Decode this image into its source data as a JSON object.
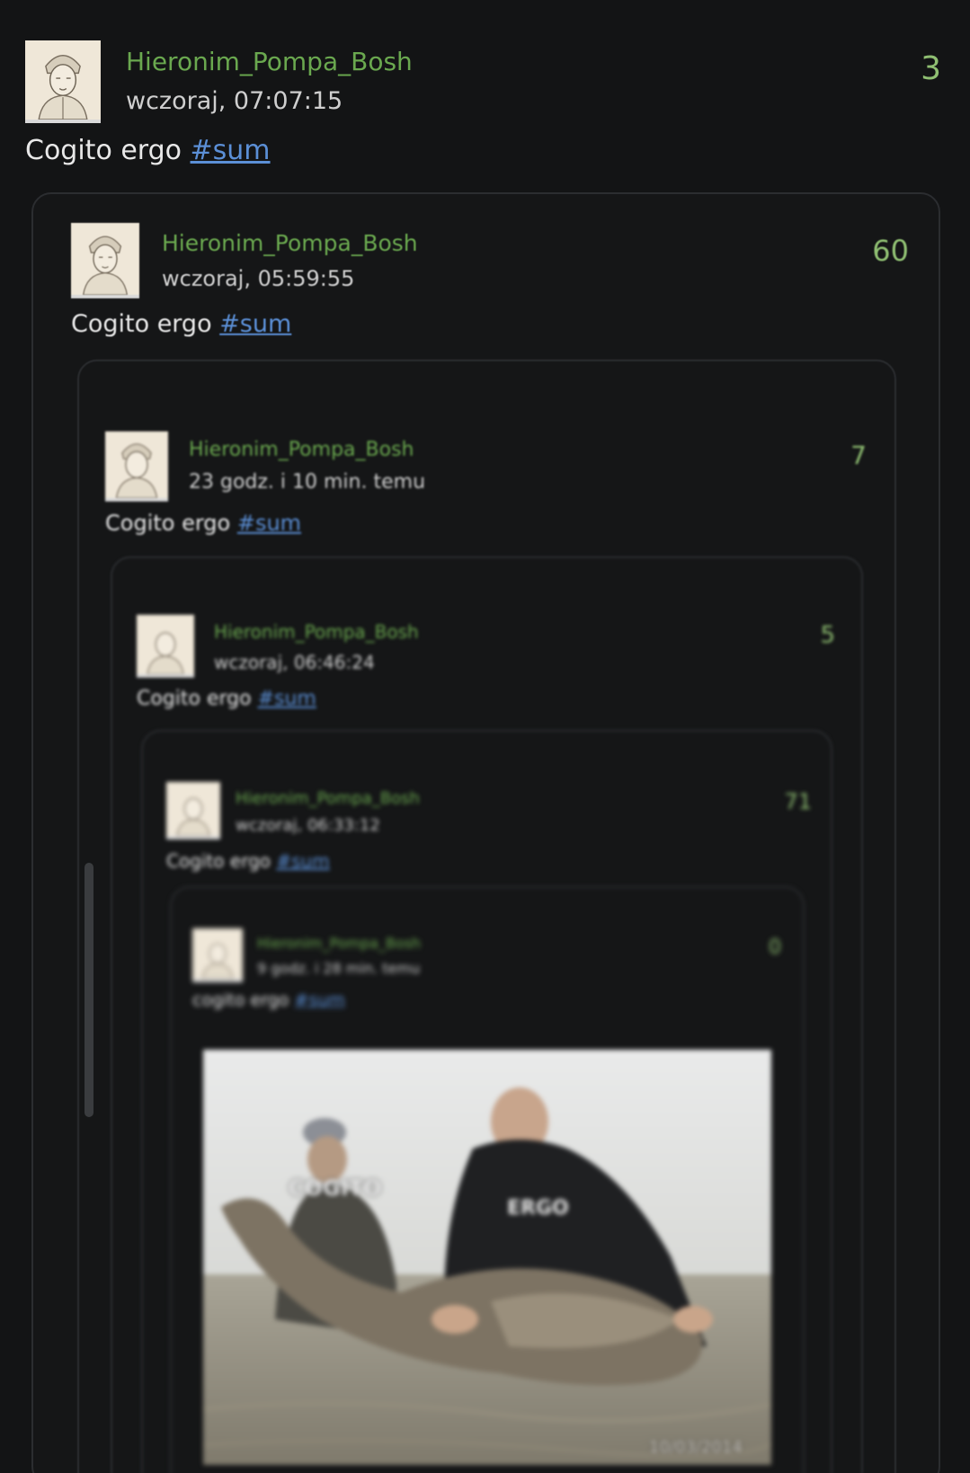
{
  "posts": [
    {
      "author": "Hieronim_Pompa_Bosh",
      "time": "wczoraj, 07:07:15",
      "score": "3",
      "text": "Cogito ergo ",
      "tag": "#sum"
    },
    {
      "author": "Hieronim_Pompa_Bosh",
      "time": "wczoraj, 05:59:55",
      "score": "60",
      "text": "Cogito ergo ",
      "tag": "#sum"
    },
    {
      "author": "Hieronim_Pompa_Bosh",
      "time": "23 godz. i 10 min. temu",
      "score": "7",
      "text": "Cogito ergo ",
      "tag": "#sum"
    },
    {
      "author": "Hieronim_Pompa_Bosh",
      "time": "wczoraj, 06:46:24",
      "score": "5",
      "text": "Cogito ergo ",
      "tag": "#sum"
    },
    {
      "author": "Hieronim_Pompa_Bosh",
      "time": "wczoraj, 06:33:12",
      "score": "71",
      "text": "Cogito ergo ",
      "tag": "#sum"
    },
    {
      "author": "Hieronim_Pompa_Bosh",
      "time": "9 godz. i 28 min. temu",
      "score": "0",
      "text": "cogito ergo ",
      "tag": "#sum"
    }
  ],
  "image": {
    "label_left": "COGITO",
    "label_right": "ERGO",
    "date_stamp": "10/03/2014"
  },
  "colors": {
    "background": "#131415",
    "author": "#6aa84f",
    "score": "#8fbf72",
    "hashtag": "#5b8fd6"
  }
}
